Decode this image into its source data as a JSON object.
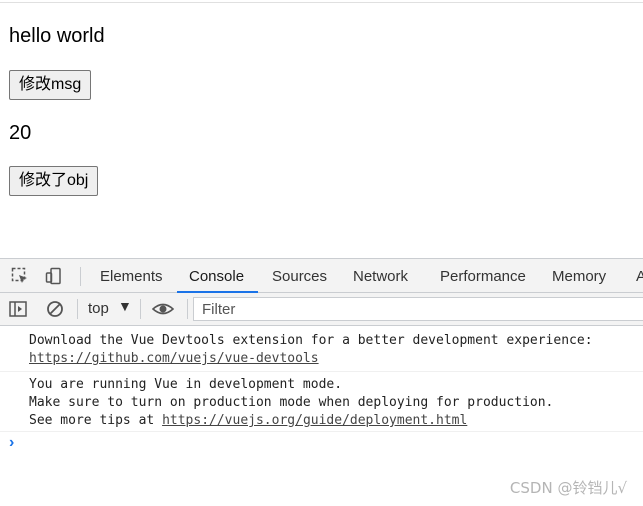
{
  "page": {
    "msg_text": "hello world",
    "modify_msg_button": "修改msg",
    "number_text": "20",
    "modify_obj_button": "修改了obj"
  },
  "devtools": {
    "tabs": [
      "Elements",
      "Console",
      "Sources",
      "Network",
      "Performance",
      "Memory",
      "A"
    ],
    "active_tab": "Console",
    "context_selector": "top",
    "filter_placeholder": "Filter",
    "accent_color": "#1a73e8",
    "messages": [
      {
        "lines": [
          "Download the Vue Devtools extension for a better development experience:"
        ],
        "link": "https://github.com/vuejs/vue-devtools"
      },
      {
        "lines": [
          "You are running Vue in development mode.",
          "Make sure to turn on production mode when deploying for production."
        ],
        "tip_prefix": "See more tips at ",
        "link": "https://vuejs.org/guide/deployment.html"
      }
    ]
  },
  "watermark": "CSDN @铃铛儿√"
}
